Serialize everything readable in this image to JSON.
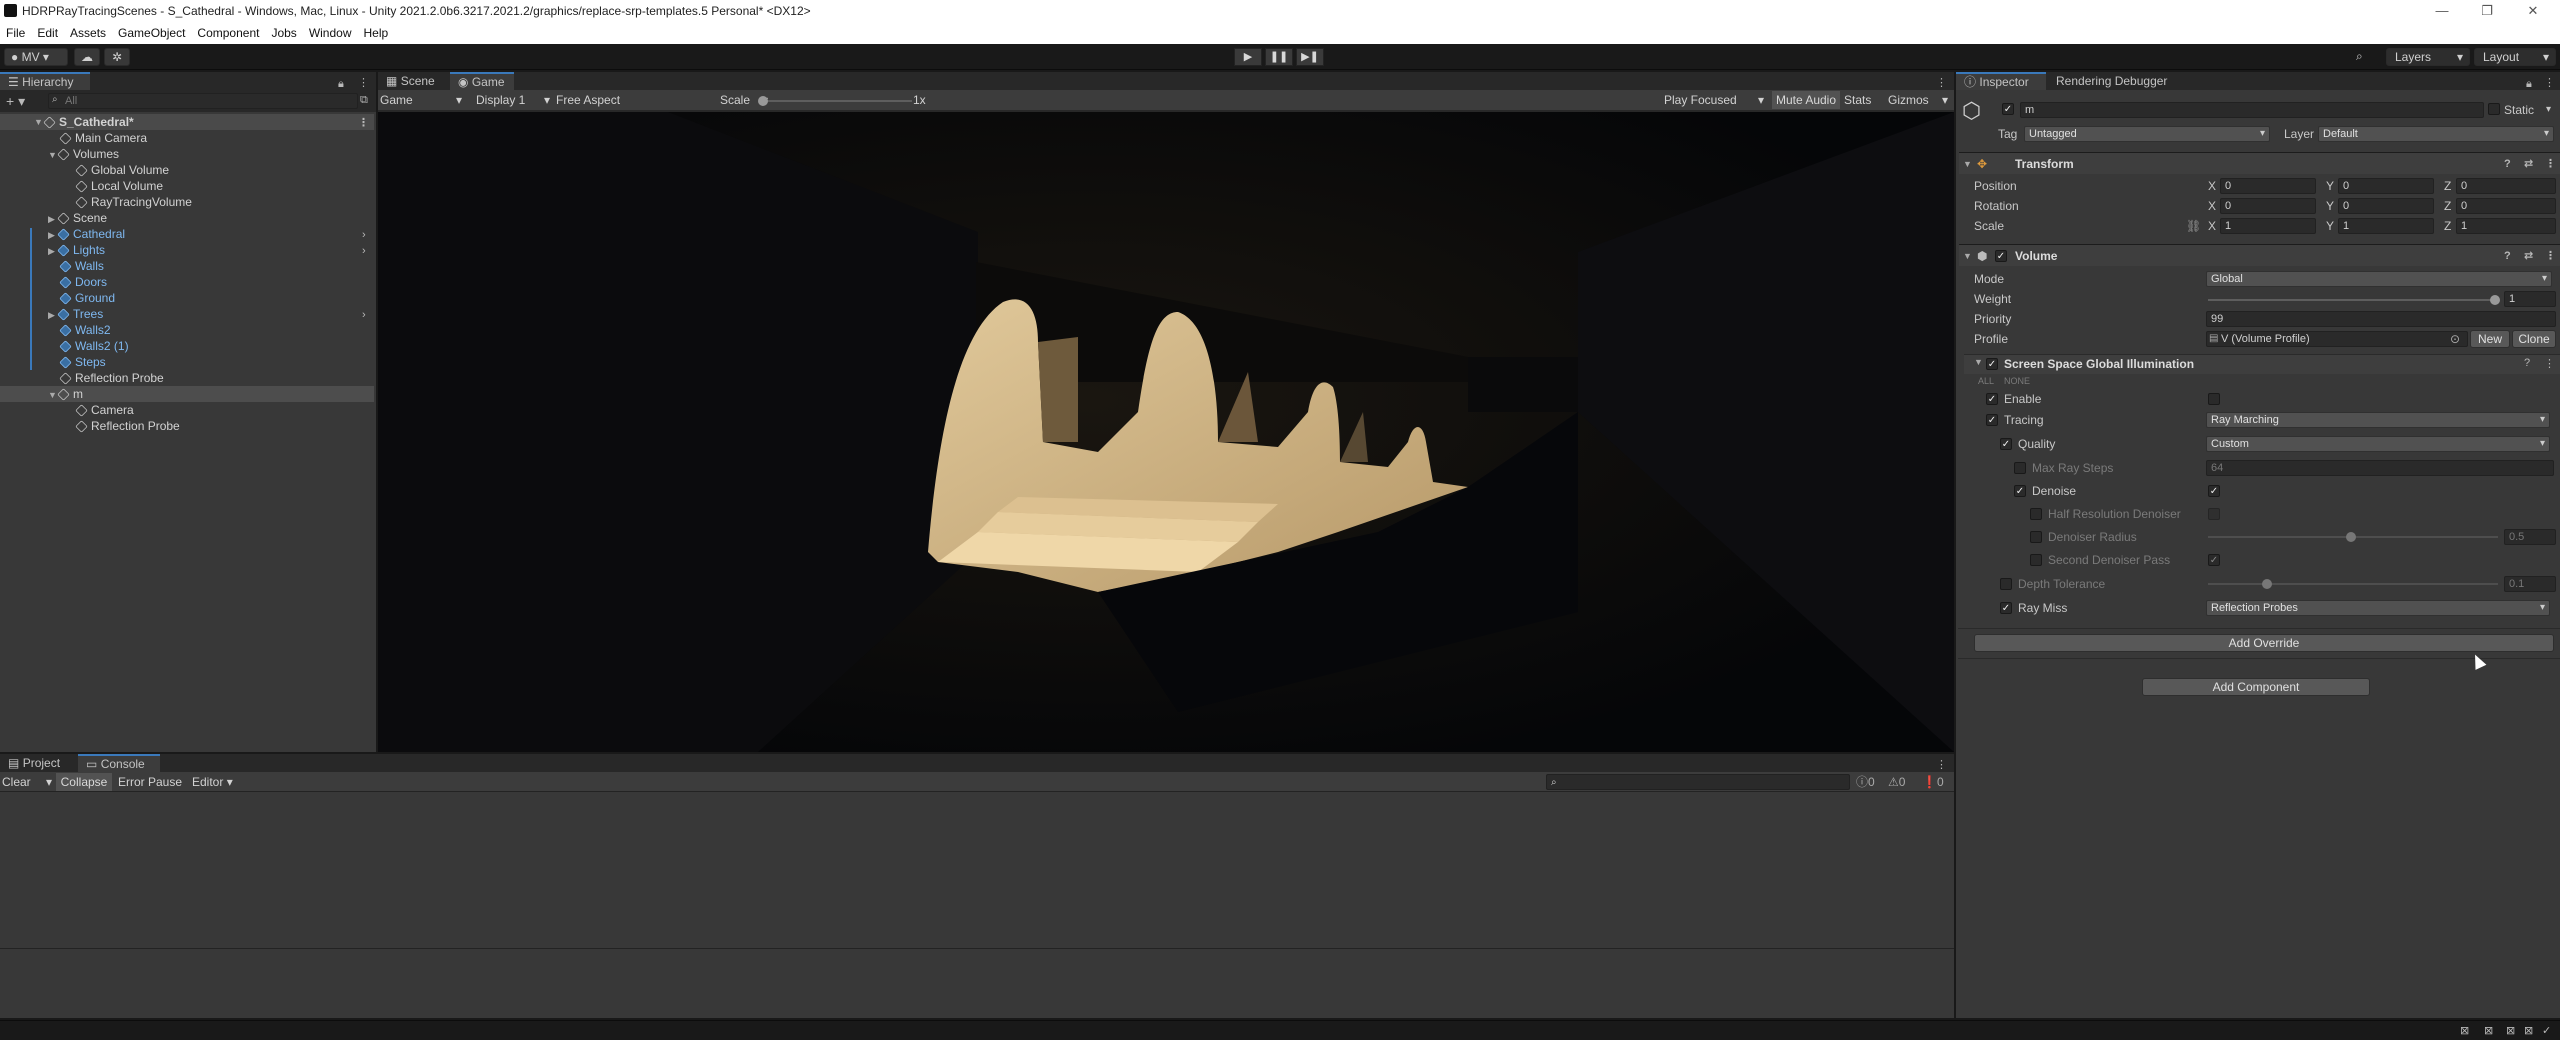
{
  "window": {
    "title": "HDRPRayTracingScenes - S_Cathedral - Windows, Mac, Linux - Unity 2021.2.0b6.3217.2021.2/graphics/replace-srp-templates.5 Personal* <DX12>"
  },
  "menu": [
    "File",
    "Edit",
    "Assets",
    "GameObject",
    "Component",
    "Jobs",
    "Window",
    "Help"
  ],
  "toolbar": {
    "account": "MV",
    "layers": "Layers",
    "layout": "Layout"
  },
  "hierarchy": {
    "tab": "Hierarchy",
    "search_placeholder": "All",
    "rows": [
      {
        "label": "S_Cathedral*"
      },
      {
        "label": "Main Camera"
      },
      {
        "label": "Volumes"
      },
      {
        "label": "Global Volume"
      },
      {
        "label": "Local Volume"
      },
      {
        "label": "RayTracingVolume"
      },
      {
        "label": "Scene"
      },
      {
        "label": "Cathedral"
      },
      {
        "label": "Lights"
      },
      {
        "label": "Walls"
      },
      {
        "label": "Doors"
      },
      {
        "label": "Ground"
      },
      {
        "label": "Trees"
      },
      {
        "label": "Walls2"
      },
      {
        "label": "Walls2 (1)"
      },
      {
        "label": "Steps"
      },
      {
        "label": "Reflection Probe"
      },
      {
        "label": "m"
      },
      {
        "label": "Camera"
      },
      {
        "label": "Reflection Probe"
      }
    ]
  },
  "view": {
    "tabs": [
      "Scene",
      "Game"
    ],
    "game_dropdown": "Game",
    "display": "Display 1",
    "aspect": "Free Aspect",
    "scale_label": "Scale",
    "scale_value": "1x",
    "play_focused": "Play Focused",
    "mute_audio": "Mute Audio",
    "stats": "Stats",
    "gizmos": "Gizmos"
  },
  "bottom": {
    "tabs": [
      "Project",
      "Console"
    ],
    "clear": "Clear",
    "collapse": "Collapse",
    "error_pause": "Error Pause",
    "editor": "Editor",
    "counts": [
      "0",
      "0",
      "0"
    ]
  },
  "inspector": {
    "tabs": [
      "Inspector",
      "Rendering Debugger"
    ],
    "object_name": "m",
    "static_label": "Static",
    "tag_label": "Tag",
    "tag_value": "Untagged",
    "layer_label": "Layer",
    "layer_value": "Default",
    "transform": {
      "title": "Transform",
      "rows": [
        {
          "label": "Position",
          "x": "0",
          "y": "0",
          "z": "0"
        },
        {
          "label": "Rotation",
          "x": "0",
          "y": "0",
          "z": "0"
        },
        {
          "label": "Scale",
          "x": "1",
          "y": "1",
          "z": "1"
        }
      ],
      "axes": [
        "X",
        "Y",
        "Z"
      ]
    },
    "volume": {
      "title": "Volume",
      "mode_label": "Mode",
      "mode_value": "Global",
      "weight_label": "Weight",
      "weight_value": "1",
      "priority_label": "Priority",
      "priority_value": "99",
      "profile_label": "Profile",
      "profile_value": "V (Volume Profile)",
      "new_btn": "New",
      "clone_btn": "Clone"
    },
    "ssgi": {
      "title": "Screen Space Global Illumination",
      "all": "ALL",
      "none": "NONE",
      "enable": "Enable",
      "tracing": "Tracing",
      "tracing_value": "Ray Marching",
      "quality": "Quality",
      "quality_value": "Custom",
      "max_ray_steps": "Max Ray Steps",
      "max_ray_steps_value": "64",
      "denoise": "Denoise",
      "half_res": "Half Resolution Denoiser",
      "denoiser_radius": "Denoiser Radius",
      "denoiser_radius_value": "0.5",
      "second_pass": "Second Denoiser Pass",
      "depth_tolerance": "Depth Tolerance",
      "depth_tolerance_value": "0.1",
      "ray_miss": "Ray Miss",
      "ray_miss_value": "Reflection Probes"
    },
    "add_override": "Add Override",
    "add_component": "Add Component"
  },
  "colors": {
    "accent": "#3a79bb",
    "panel": "#383838",
    "dark": "#191919",
    "blue_text": "#7fb8f0"
  }
}
